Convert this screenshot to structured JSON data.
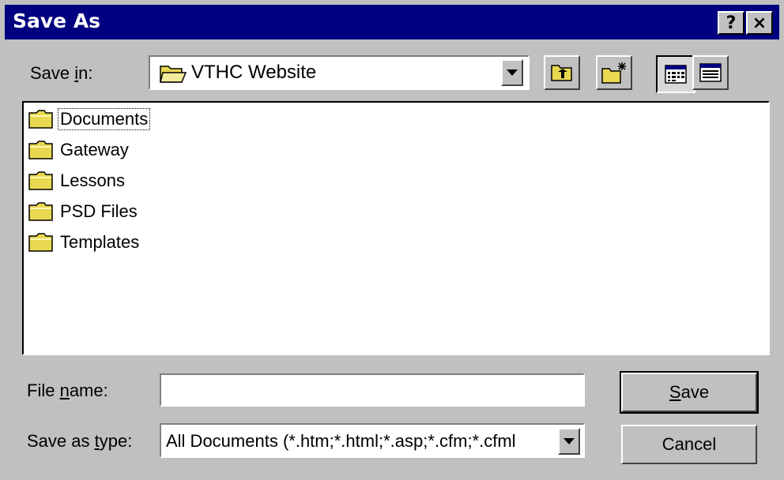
{
  "window": {
    "title": "Save As",
    "help_label": "?",
    "close_label": "×"
  },
  "save_in": {
    "label_prefix": "Save ",
    "label_accel": "i",
    "label_suffix": "n:",
    "value": "VTHC Website",
    "icon": "open-folder-icon"
  },
  "toolbar": {
    "buttons": [
      {
        "name": "up-one-level",
        "icon": "folder-up-icon"
      },
      {
        "name": "create-new-folder",
        "icon": "new-folder-icon"
      },
      {
        "name": "list-view",
        "icon": "list-view-icon",
        "pressed": true
      },
      {
        "name": "details-view",
        "icon": "details-view-icon"
      }
    ]
  },
  "files": [
    {
      "name": "Documents",
      "icon": "folder-icon",
      "focused": true
    },
    {
      "name": "Gateway",
      "icon": "folder-icon"
    },
    {
      "name": "Lessons",
      "icon": "folder-icon"
    },
    {
      "name": "PSD Files",
      "icon": "folder-icon"
    },
    {
      "name": "Templates",
      "icon": "folder-icon"
    }
  ],
  "file_name": {
    "label_prefix": "File ",
    "label_accel": "n",
    "label_suffix": "ame:",
    "value": ""
  },
  "save_as_type": {
    "label_prefix": "Save as ",
    "label_accel": "t",
    "label_suffix": "ype:",
    "value": "All Documents (*.htm;*.html;*.asp;*.cfm;*.cfml"
  },
  "buttons": {
    "save_accel": "S",
    "save_rest": "ave",
    "cancel": "Cancel"
  },
  "colors": {
    "title_bar": "#000080",
    "face": "#c0c0c0",
    "folder": "#e8d850"
  }
}
